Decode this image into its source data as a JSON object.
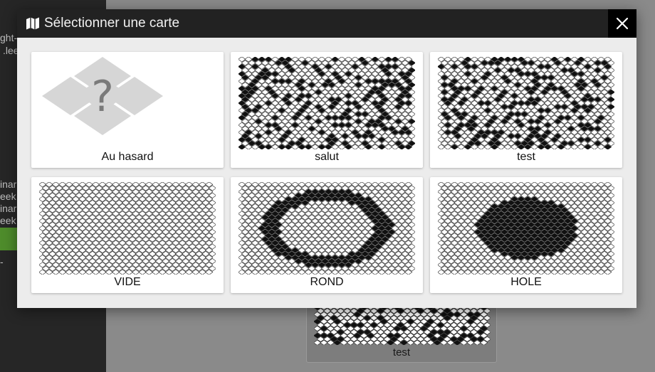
{
  "background": {
    "fragments": [
      "ght-",
      ".lee",
      "inar",
      "eek",
      "inar",
      "eek",
      "-"
    ],
    "card_label": "test"
  },
  "modal": {
    "title": "Sélectionner une carte",
    "close_icon": "close-icon",
    "title_icon": "map-icon"
  },
  "maps": [
    {
      "label": "Au hasard",
      "pattern": "random-icon"
    },
    {
      "label": "salut",
      "pattern": "scatter"
    },
    {
      "label": "test",
      "pattern": "scatter"
    },
    {
      "label": "VIDE",
      "pattern": "empty"
    },
    {
      "label": "ROND",
      "pattern": "ring"
    },
    {
      "label": "HOLE",
      "pattern": "filled"
    }
  ],
  "colors": {
    "header": "#222222",
    "modal_bg": "#ececec",
    "card_bg": "#ffffff",
    "cell_filled": "#111111"
  }
}
